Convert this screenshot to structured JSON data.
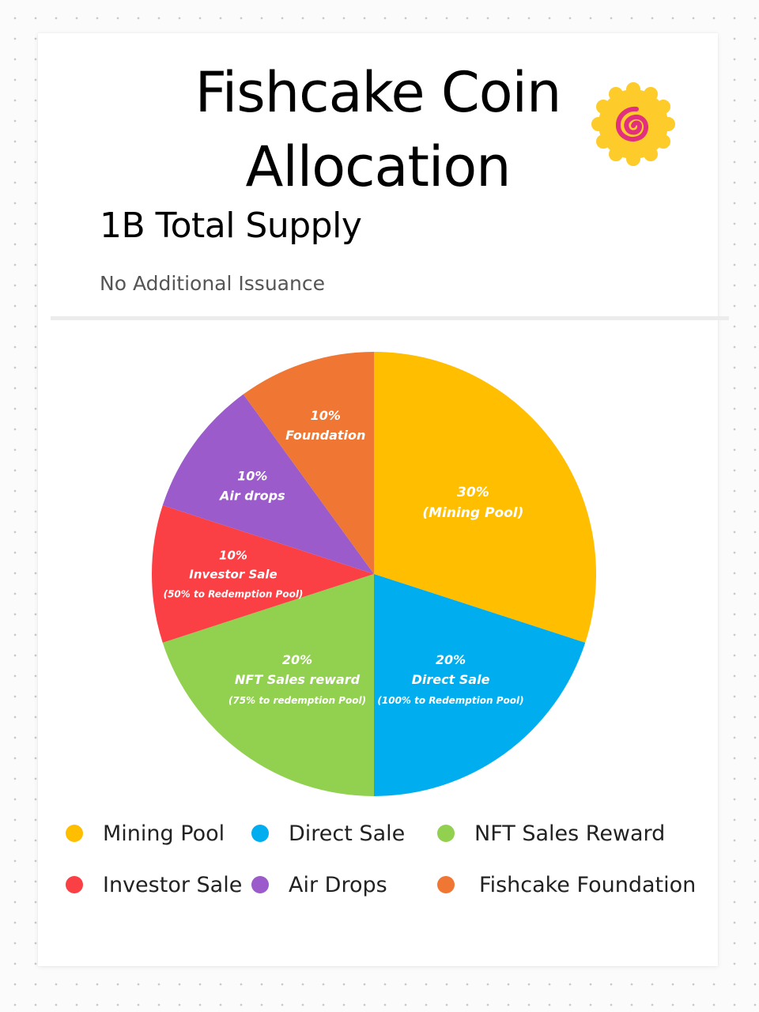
{
  "card": {
    "title_line1": "Fishcake Coin",
    "title_line2": "Allocation",
    "subtitle": "1B Total Supply",
    "note": "No Additional Issuance",
    "logo_icon": "fishcake-swirl-icon"
  },
  "chart_data": {
    "type": "pie",
    "unit": "%",
    "slices": [
      {
        "name": "Mining Pool",
        "value": 30,
        "color": "#FFBE00",
        "label_lines": [
          "30%",
          "(Mining Pool)"
        ]
      },
      {
        "name": "Direct Sale",
        "value": 20,
        "color": "#00AEEF",
        "label_lines": [
          "20%",
          "Direct Sale",
          "(100% to Redemption Pool)"
        ]
      },
      {
        "name": "NFT Sales Reward",
        "value": 20,
        "color": "#92D050",
        "label_lines": [
          "20%",
          "NFT Sales reward",
          "(75% to redemption Pool)"
        ]
      },
      {
        "name": "Investor Sale",
        "value": 10,
        "color": "#FA4045",
        "label_lines": [
          "10%",
          "Investor Sale",
          "(50% to Redemption Pool)"
        ]
      },
      {
        "name": "Air Drops",
        "value": 10,
        "color": "#9B5BCB",
        "label_lines": [
          "10%",
          "Air drops"
        ]
      },
      {
        "name": "Fishcake Foundation",
        "value": 10,
        "color": "#F07733",
        "label_lines": [
          "10%",
          "Foundation"
        ]
      }
    ],
    "legend": [
      "Mining Pool",
      "Direct Sale",
      "NFT Sales Reward",
      "Investor Sale",
      "Air Drops",
      "Fishcake Foundation"
    ],
    "legend_placement": "bottom"
  }
}
